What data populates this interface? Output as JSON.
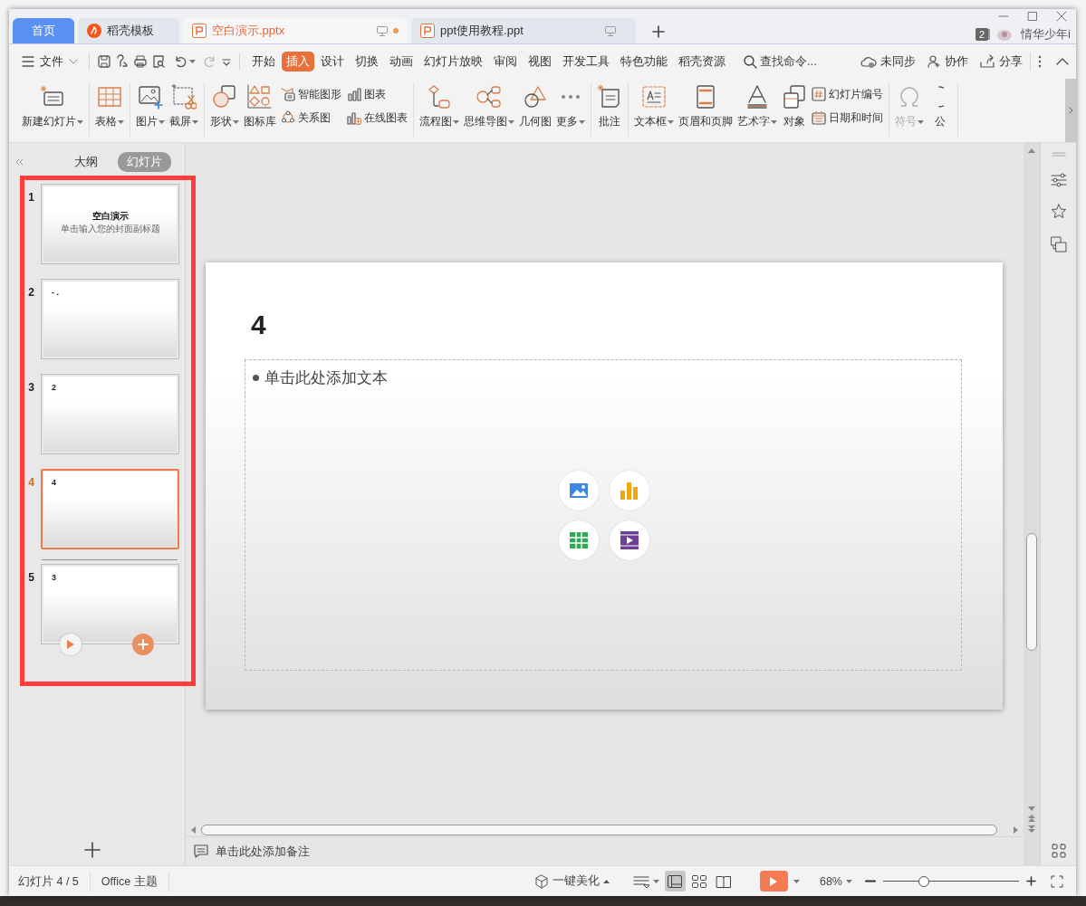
{
  "window": {
    "tabs": [
      {
        "label": "首页",
        "kind": "home",
        "selected": false
      },
      {
        "label": "稻壳模板",
        "kind": "docer",
        "selected": false
      },
      {
        "label": "空白演示.pptx",
        "kind": "document",
        "selected": true,
        "unsaved": true
      },
      {
        "label": "ppt使用教程.ppt",
        "kind": "document",
        "selected": false,
        "unsaved": false
      }
    ],
    "window_count": "2",
    "user": "情华少年i"
  },
  "menu": {
    "file": "文件",
    "tabs": [
      {
        "label": "开始",
        "selected": false
      },
      {
        "label": "插入",
        "selected": true
      },
      {
        "label": "设计",
        "selected": false
      },
      {
        "label": "切换",
        "selected": false
      },
      {
        "label": "动画",
        "selected": false
      },
      {
        "label": "幻灯片放映",
        "selected": false
      },
      {
        "label": "审阅",
        "selected": false
      },
      {
        "label": "视图",
        "selected": false
      },
      {
        "label": "开发工具",
        "selected": false
      },
      {
        "label": "特色功能",
        "selected": false
      },
      {
        "label": "稻壳资源",
        "selected": false
      }
    ],
    "search": {
      "placeholder": "查找命令..."
    },
    "actions": [
      "未同步",
      "协作",
      "分享"
    ]
  },
  "ribbon": {
    "groups": [
      [
        {
          "kind": "large",
          "label": "新建幻灯片",
          "dropdown": true,
          "disabled": false
        }
      ],
      [
        {
          "kind": "large",
          "label": "表格",
          "dropdown": true,
          "disabled": false
        }
      ],
      [
        {
          "kind": "large",
          "label": "图片",
          "dropdown": true,
          "disabled": false
        },
        {
          "kind": "large",
          "label": "截屏",
          "dropdown": true,
          "disabled": false
        }
      ],
      [
        {
          "kind": "large",
          "label": "形状",
          "dropdown": true,
          "disabled": false
        },
        {
          "kind": "large",
          "label": "图标库",
          "dropdown": false,
          "disabled": false
        },
        {
          "kind": "small",
          "label": "智能图形",
          "dropdown": false,
          "disabled": false
        },
        {
          "kind": "small",
          "label": "关系图",
          "dropdown": false,
          "disabled": false
        },
        {
          "kind": "small",
          "label": "图表",
          "dropdown": false,
          "disabled": false
        },
        {
          "kind": "small",
          "label": "在线图表",
          "dropdown": false,
          "disabled": false
        }
      ],
      [
        {
          "kind": "large",
          "label": "流程图",
          "dropdown": true,
          "disabled": false
        },
        {
          "kind": "large",
          "label": "思维导图",
          "dropdown": true,
          "disabled": false
        },
        {
          "kind": "large",
          "label": "几何图",
          "dropdown": false,
          "disabled": false
        },
        {
          "kind": "large",
          "label": "更多",
          "dropdown": true,
          "disabled": false
        }
      ],
      [
        {
          "kind": "large",
          "label": "批注",
          "dropdown": false,
          "disabled": false
        }
      ],
      [
        {
          "kind": "large",
          "label": "文本框",
          "dropdown": true,
          "disabled": false
        },
        {
          "kind": "large",
          "label": "页眉和页脚",
          "dropdown": false,
          "disabled": false
        },
        {
          "kind": "large",
          "label": "艺术字",
          "dropdown": true,
          "disabled": false
        },
        {
          "kind": "large",
          "label": "对象",
          "dropdown": false,
          "disabled": false
        },
        {
          "kind": "small",
          "label": "幻灯片编号",
          "dropdown": false,
          "disabled": false
        },
        {
          "kind": "small",
          "label": "日期和时间",
          "dropdown": false,
          "disabled": false
        }
      ],
      [
        {
          "kind": "large",
          "label": "符号",
          "dropdown": true,
          "disabled": true
        },
        {
          "kind": "large",
          "label": "公",
          "dropdown": false,
          "disabled": false
        }
      ]
    ]
  },
  "panel": {
    "tabs": [
      {
        "label": "大纲",
        "selected": false
      },
      {
        "label": "幻灯片",
        "selected": true
      }
    ],
    "slides": [
      {
        "number": "1",
        "kind": "title",
        "title": "空白演示",
        "subtitle": "单击输入您的封面副标题",
        "selected": false
      },
      {
        "number": "2",
        "kind": "content",
        "title": "- .",
        "selected": false
      },
      {
        "number": "3",
        "kind": "content",
        "title": "2",
        "selected": false
      },
      {
        "number": "4",
        "kind": "content",
        "title": "4",
        "selected": true
      },
      {
        "number": "5",
        "kind": "content",
        "title": "3",
        "selected": false
      }
    ]
  },
  "editor": {
    "title": "4",
    "placeholder": "单击此处添加文本",
    "notes_placeholder": "单击此处添加备注"
  },
  "status_bar": {
    "slide": "幻灯片 4 / 5",
    "theme": "Office 主题",
    "beautify": "一键美化",
    "views": [
      {
        "selected": true
      },
      {
        "selected": false
      },
      {
        "selected": false
      }
    ],
    "zoom": "68%",
    "zoom_slider": {
      "level": 0.3
    }
  }
}
